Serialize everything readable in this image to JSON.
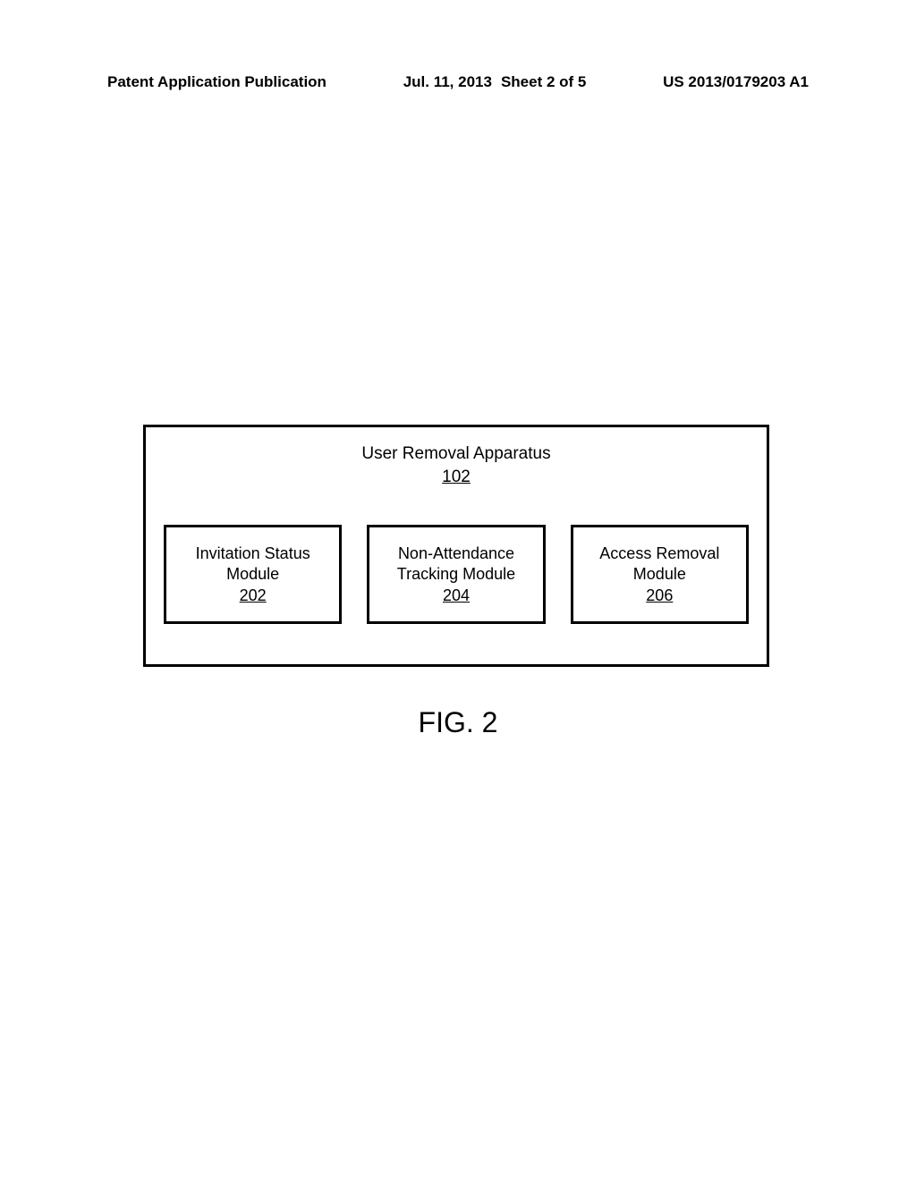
{
  "header": {
    "publication_label": "Patent Application Publication",
    "date": "Jul. 11, 2013",
    "sheet_info": "Sheet 2 of 5",
    "pub_number": "US 2013/0179203 A1"
  },
  "diagram": {
    "outer": {
      "title": "User Removal Apparatus",
      "ref": "102"
    },
    "modules": [
      {
        "title_line1": "Invitation Status",
        "title_line2": "Module",
        "ref": "202"
      },
      {
        "title_line1": "Non-Attendance",
        "title_line2": "Tracking Module",
        "ref": "204"
      },
      {
        "title_line1": "Access Removal",
        "title_line2": "Module",
        "ref": "206"
      }
    ]
  },
  "figure_label": "FIG. 2"
}
